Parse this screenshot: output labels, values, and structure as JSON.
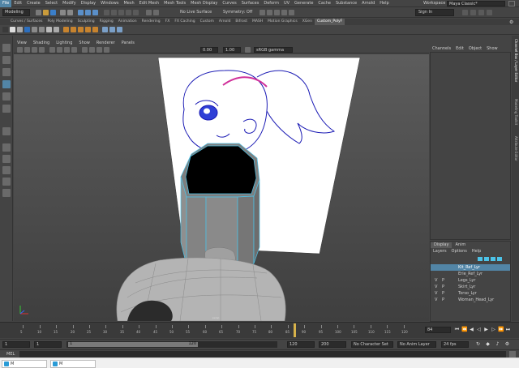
{
  "menubar": {
    "items": [
      "File",
      "Edit",
      "Create",
      "Select",
      "Modify",
      "Display",
      "Windows",
      "Mesh",
      "Edit Mesh",
      "Mesh Tools",
      "Mesh Display",
      "Curves",
      "Surfaces",
      "Deform",
      "UV",
      "Generate",
      "Cache",
      "Substance",
      "Arnold",
      "Help"
    ],
    "workspace_label": "Workspace :",
    "workspace_value": "Maya Classic*"
  },
  "statusline": {
    "mode": "Modeling",
    "live_surface": "No Live Surface",
    "symmetry": "Symmetry: Off",
    "sign_in": "Sign In"
  },
  "shelf": {
    "tabs": [
      "Curves / Surfaces",
      "Poly Modeling",
      "Sculpting",
      "Rigging",
      "Animation",
      "Rendering",
      "FX",
      "FX Caching",
      "Custom",
      "Arnold",
      "Bifrost",
      "MASH",
      "Motion Graphics",
      "XGen",
      "Custom_PolyF"
    ],
    "active_tab": "Custom_PolyF"
  },
  "panel": {
    "menu": [
      "View",
      "Shading",
      "Lighting",
      "Show",
      "Renderer",
      "Panels"
    ],
    "field_a": "0.00",
    "field_b": "1.00",
    "color_space": "sRGB gamma",
    "camera_label": "persp"
  },
  "channel_box": {
    "menu": [
      "Channels",
      "Edit",
      "Object",
      "Show"
    ]
  },
  "right_tabs": [
    "Channel Box / Layer Editor",
    "Modeling Toolkit",
    "Attribute Editor"
  ],
  "layers": {
    "tabs": [
      "Display",
      "Anim"
    ],
    "menu": [
      "Layers",
      "Options",
      "Help"
    ],
    "rows": [
      {
        "v": "",
        "p": "",
        "name": "Kit_Ref_Lyr",
        "selected": true
      },
      {
        "v": "",
        "p": "",
        "name": "Erie_Ref_Lyr",
        "selected": false
      },
      {
        "v": "V",
        "p": "P",
        "name": "Legs_Lyr",
        "selected": false
      },
      {
        "v": "V",
        "p": "P",
        "name": "Skirt_Lyr",
        "selected": false
      },
      {
        "v": "V",
        "p": "P",
        "name": "Torso_Lyr",
        "selected": false
      },
      {
        "v": "V",
        "p": "P",
        "name": "Woman_Head_Lyr",
        "selected": false
      }
    ]
  },
  "timeslider": {
    "ticks": [
      "5",
      "10",
      "15",
      "20",
      "25",
      "30",
      "35",
      "40",
      "45",
      "50",
      "55",
      "60",
      "65",
      "70",
      "75",
      "80",
      "85",
      "90",
      "95",
      "100",
      "105",
      "110",
      "115",
      "120"
    ],
    "current_frame": "84"
  },
  "range": {
    "start": "1",
    "start_inner": "1",
    "slider_start": "1",
    "slider_end": "120",
    "end_inner": "120",
    "end": "200",
    "character_set": "No Character Set",
    "anim_layer": "No Anim Layer",
    "fps": "24 fps"
  },
  "cmdline": {
    "label": "MEL"
  },
  "taskbar": {
    "items": [
      "M",
      "M"
    ]
  },
  "colors": {
    "selection": "#5285a6",
    "wireframe": "#4cc3e8",
    "drawing_outline": "#1a1ab4",
    "headband": "#d0309a"
  }
}
